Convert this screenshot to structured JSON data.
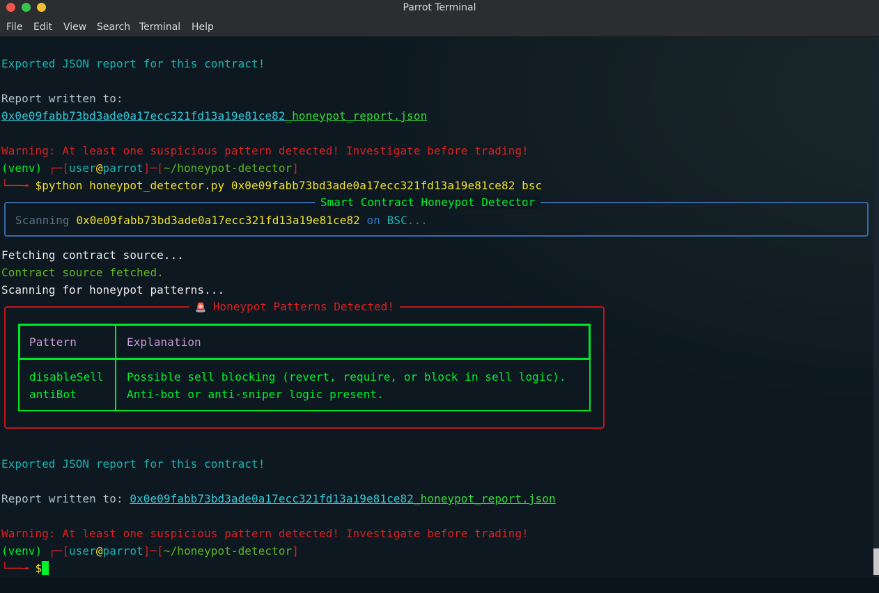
{
  "window": {
    "title": "Parrot Terminal"
  },
  "menu": {
    "file": "File",
    "edit": "Edit",
    "view": "View",
    "search": "Search",
    "terminal": "Terminal",
    "help": "Help"
  },
  "terminal": {
    "exported_msg": "Exported JSON report for this contract!",
    "report_label": "Report written to:",
    "report_file": "0x0e09fabb73bd3ade0a17ecc321fd13a19e81ce82",
    "report_suffix": "_honeypot_report.json",
    "warning": "Warning: At least one suspicious pattern detected! Investigate before trading!",
    "prompt": {
      "venv": "(venv) ",
      "corner_top": "┌─[",
      "user": "user",
      "at": "@",
      "host": "parrot",
      "mid": "]─[",
      "path": "~/honeypot-detector",
      "close": "]",
      "corner_bottom": "└──╼ ",
      "dollar": "$"
    },
    "command": "python honeypot_detector.py 0x0e09fabb73bd3ade0a17ecc321fd13a19e81ce82 bsc",
    "detector_panel": {
      "title": "Smart Contract Honeypot Detector",
      "scanning": "Scanning ",
      "address": "0x0e09fabb73bd3ade0a17ecc321fd13a19e81ce82",
      "on": " on ",
      "chain": "BSC",
      "dots": "..."
    },
    "fetching": "Fetching contract source...",
    "fetched": "Contract source fetched.",
    "scanning_patterns": "Scanning for honeypot patterns...",
    "patterns_panel": {
      "icon": "🚨",
      "title": "Honeypot Patterns Detected!",
      "header_pattern": "Pattern",
      "header_explanation": "Explanation",
      "rows": [
        {
          "pattern": "disableSell",
          "explanation": "Possible sell blocking (revert, require, or block in sell logic)."
        },
        {
          "pattern": "antiBot",
          "explanation": "Anti-bot or anti-sniper logic present."
        }
      ]
    }
  },
  "colors": {
    "accent_green": "#00e823",
    "warning_red": "#dd1f1f",
    "panel_blue": "#3868a8",
    "cyan": "#1fb3b3"
  }
}
